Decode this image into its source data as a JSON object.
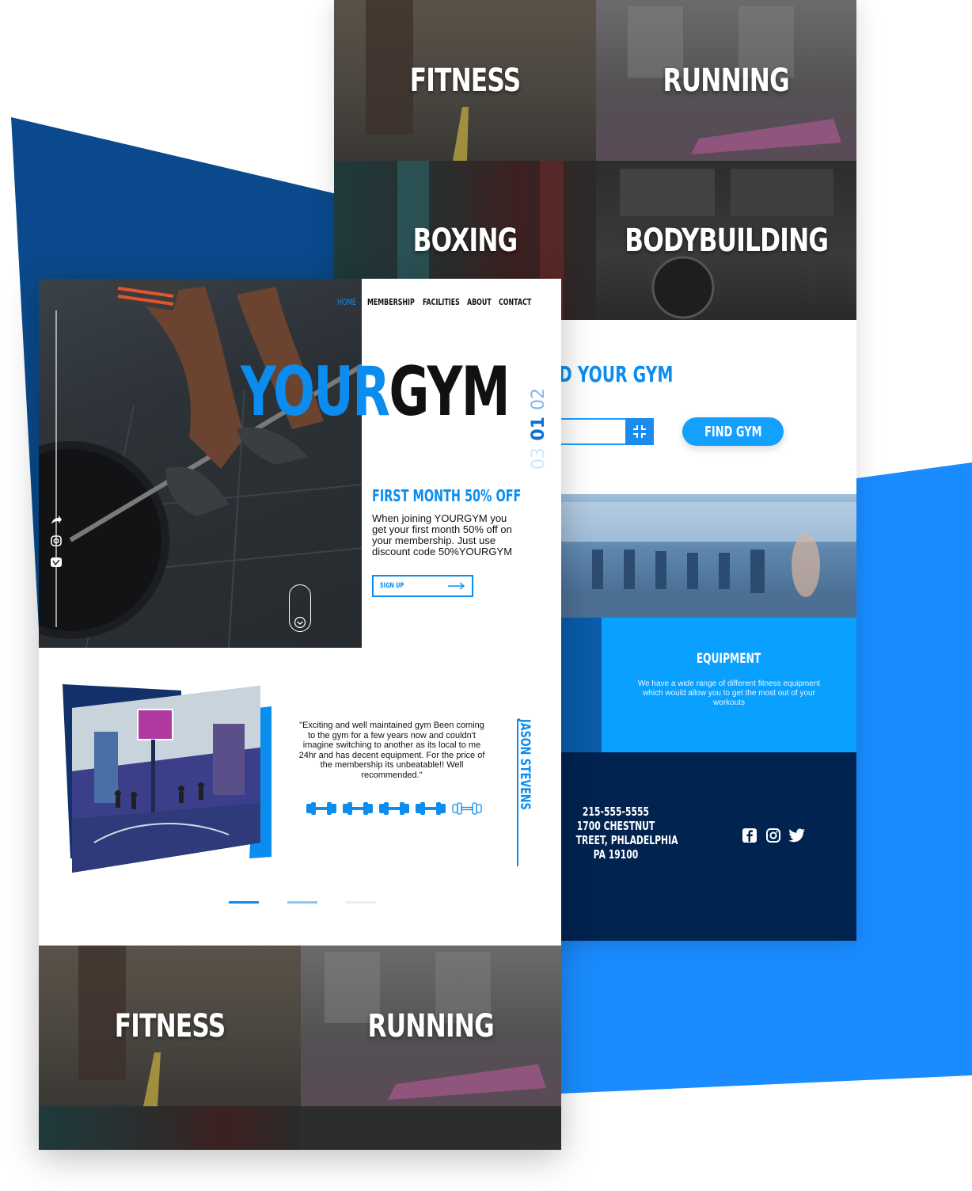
{
  "colors": {
    "accent": "#0b8df0",
    "dark_blue": "#0a4a8c",
    "bright_blue": "#1a8cff",
    "navy": "#012350",
    "equipment_bg": "#0aa0ff"
  },
  "back_page": {
    "tiles": [
      {
        "label": "FITNESS"
      },
      {
        "label": "RUNNING"
      },
      {
        "label": "BOXING"
      },
      {
        "label": "BODYBUILDING"
      }
    ],
    "find_gym": {
      "title": "D YOUR GYM",
      "input_icon": "compress-icon",
      "button_label": "FIND GYM"
    },
    "equipment": {
      "title": "EQUIPMENT",
      "text": "We have a wide range of different fitness equipment which would allow you to get the most out of your workouts"
    },
    "footer": {
      "phone": "215-555-5555",
      "address_line1": "1700 CHESTNUT",
      "address_line2": "TREET, PHLADELPHIA",
      "address_line3": "PA 19100",
      "social": [
        "facebook-icon",
        "instagram-icon",
        "twitter-icon"
      ]
    }
  },
  "front_page": {
    "nav": [
      {
        "label": "HOME",
        "active": true
      },
      {
        "label": "MEMBERSHIP",
        "active": false
      },
      {
        "label": "FACILITIES",
        "active": false
      },
      {
        "label": "ABOUT",
        "active": false
      },
      {
        "label": "CONTACT",
        "active": false
      }
    ],
    "hero": {
      "title_your": "YOUR",
      "title_gym": "GYM",
      "slide_numbers": [
        "02",
        "01",
        "03"
      ],
      "active_slide": "01"
    },
    "promo": {
      "title": "FIRST MONTH 50% OFF",
      "text": "When joining YOURGYM you get your first month 50% off on your membership. Just use discount code 50%YOURGYM",
      "signup_label": "SIGN UP"
    },
    "testimonial": {
      "quote": "\"Exciting and well maintained gym Been coming to the gym for a few years now and couldn't imagine switching to another as its local to me 24hr and has decent equipment. For the price of the membership its unbeatable!! Well recommended.\"",
      "author": "JASON STEVENS",
      "rating": 4,
      "rating_max": 5
    },
    "tiles": [
      {
        "label": "FITNESS"
      },
      {
        "label": "RUNNING"
      }
    ]
  }
}
